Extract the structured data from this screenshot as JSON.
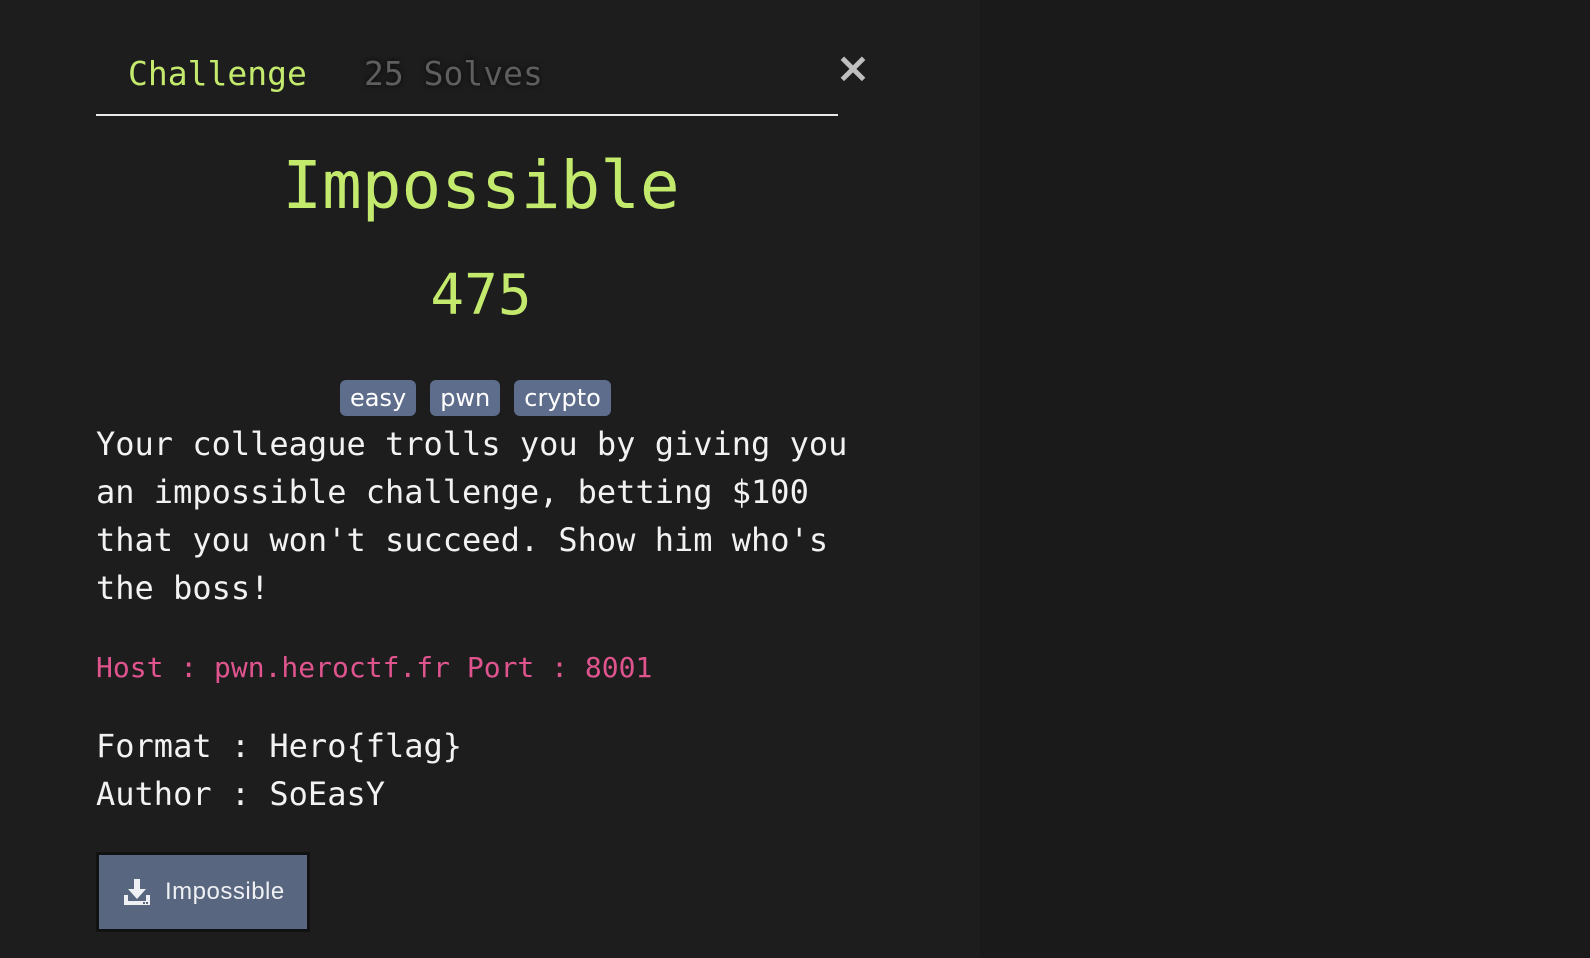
{
  "tabs": {
    "challenge_label": "Challenge",
    "solves_label": "25 Solves"
  },
  "close_icon": "×",
  "challenge": {
    "name": "Impossible",
    "points": "475",
    "tags": [
      "easy",
      "pwn",
      "crypto"
    ],
    "description": "Your colleague trolls you by giving you an impossible challenge, betting $100 that you won't succeed. Show him who's the boss!",
    "connection": "Host : pwn.heroctf.fr Port : 8001",
    "format": "Format : Hero{flag}",
    "author": "Author : SoEasY"
  },
  "download": {
    "label": "Impossible",
    "icon": "download-icon"
  },
  "colors": {
    "accent": "#c3ea6c",
    "host": "#e0548e",
    "tag_bg": "#5f6d8c",
    "background": "#1d1d1e"
  }
}
